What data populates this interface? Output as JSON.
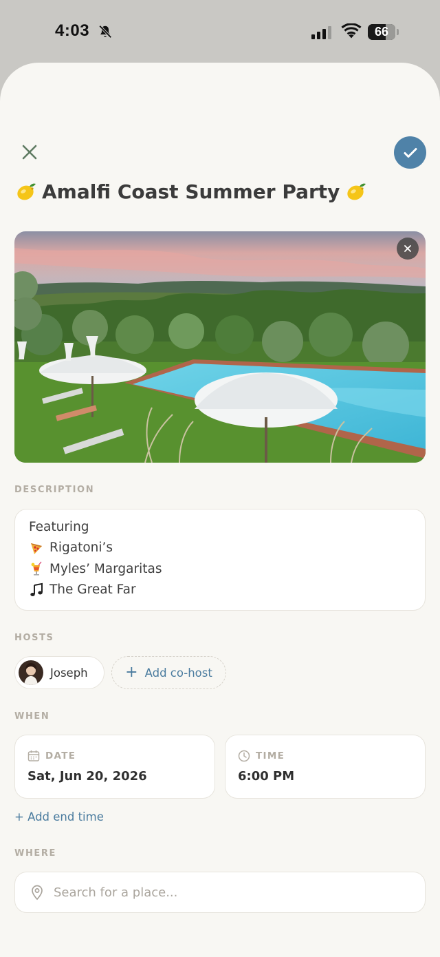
{
  "status_bar": {
    "time": "4:03",
    "battery": "66",
    "battery_level": 0.66
  },
  "header": {
    "close_icon": "close-icon",
    "confirm_icon": "check-icon"
  },
  "event": {
    "title": "Amalfi Coast Summer Party",
    "title_emoji": "lemon"
  },
  "photo": {
    "remove_icon": "close-icon"
  },
  "description": {
    "label": "DESCRIPTION",
    "lines": [
      {
        "emoji": "",
        "text": "Featuring"
      },
      {
        "emoji": "pizza",
        "text": "Rigatoni’s"
      },
      {
        "emoji": "tropical-drink",
        "text": "Myles’ Margaritas"
      },
      {
        "emoji": "music-note",
        "text": "The Great Far"
      }
    ]
  },
  "hosts": {
    "label": "HOSTS",
    "host_name": "Joseph",
    "add_cohost": "Add co-host"
  },
  "when": {
    "label": "WHEN",
    "date_label": "DATE",
    "date_value": "Sat, Jun 20, 2026",
    "time_label": "TIME",
    "time_value": "6:00 PM",
    "add_end_time": "+ Add end time"
  },
  "where": {
    "label": "WHERE",
    "placeholder": "Search for a place..."
  },
  "colors": {
    "accent": "#4f82a8",
    "link": "#4b7c9f",
    "background": "#f8f7f3",
    "label": "#b3ada3"
  }
}
